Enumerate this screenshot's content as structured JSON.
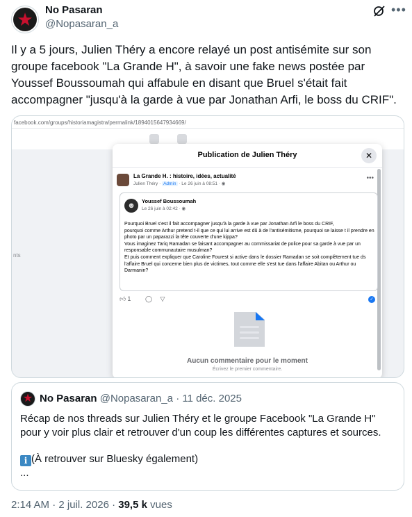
{
  "author": {
    "name": "No Pasaran",
    "handle": "@Nopasaran_a"
  },
  "tweet": {
    "text": "Il y a 5 jours, Julien Théry a encore relayé un post antisémite sur son groupe facebook \"La Grande H\", à savoir une fake news postée par Youssef Boussoumah qui affabule en disant que Bruel s'était fait accompagner \"jusqu'à la garde à vue par Jonathan Arfi, le boss du CRIF\"."
  },
  "media": {
    "url": "facebook.com/groups/historiamagistra/permalink/1894015647934669/",
    "side_label": "nts",
    "modal_title": "Publication de Julien Théry",
    "close_glyph": "✕",
    "group_name": "La Grande H. : histoire, idées, actualité",
    "group_author": "Julien Théry",
    "admin_badge": "Admin",
    "group_date": "Le 26 juin à 08:51",
    "shared_author": "Youssef Boussoumah",
    "shared_date": "Le 26 juin à 02:42",
    "shared_text": "Pourquoi Bruel s'est il fait accompagner jusqu'à la garde à vue par Jonathan Arfi  le boss du CRIF,\npourquoi comme Arthur pretend t-il que ce qui lui arrive est dû à de l'antisémitisme, pourquoi se laisse t il prendre en photo par un paparazzi la tête couverte d'une kippa?\nVous imaginez Tariq Ramadan se faisant accompagner au commissariat de police pour sa garde à vue par un responsable communautaire musulman?\nEt puis comment expliquer que Caroline Fourest si active dans le dossier Ramadan se soit complètement tue ds l'affaire Bruel qui concerne  bien plus de victimes, tout comme elle s'est tue dans l'affaire Abitan ou Arthur ou Darmanin?",
    "like_count": "1",
    "no_comment": "Aucun commentaire pour le moment",
    "first_comment": "Écrivez le premier commentaire."
  },
  "quote": {
    "name": "No Pasaran",
    "handle": "@Nopasaran_a",
    "date": "· 11 déc. 2025",
    "text": "Récap de nos threads sur Julien Théry et le groupe Facebook \"La Grande H\" pour y voir plus clair et retrouver d'un coup les différentes captures et sources.",
    "info_glyph": "i",
    "line2": "(À retrouver sur Bluesky également)",
    "ellipsis": "..."
  },
  "footer": {
    "time_date": "2:14 AM · 2 juil. 2026 · ",
    "views_count": "39,5 k",
    "views_label": " vues"
  },
  "icons": {
    "grok": "grok-icon",
    "more": "more-icon",
    "like": "thumb-up-icon",
    "comment": "comment-icon",
    "share": "share-icon",
    "document": "document-icon"
  },
  "colors": {
    "text": "#0f1419",
    "secondary": "#536471",
    "border": "#cfd9de",
    "fb_blue": "#1877f2",
    "star_red": "#c8102e"
  }
}
